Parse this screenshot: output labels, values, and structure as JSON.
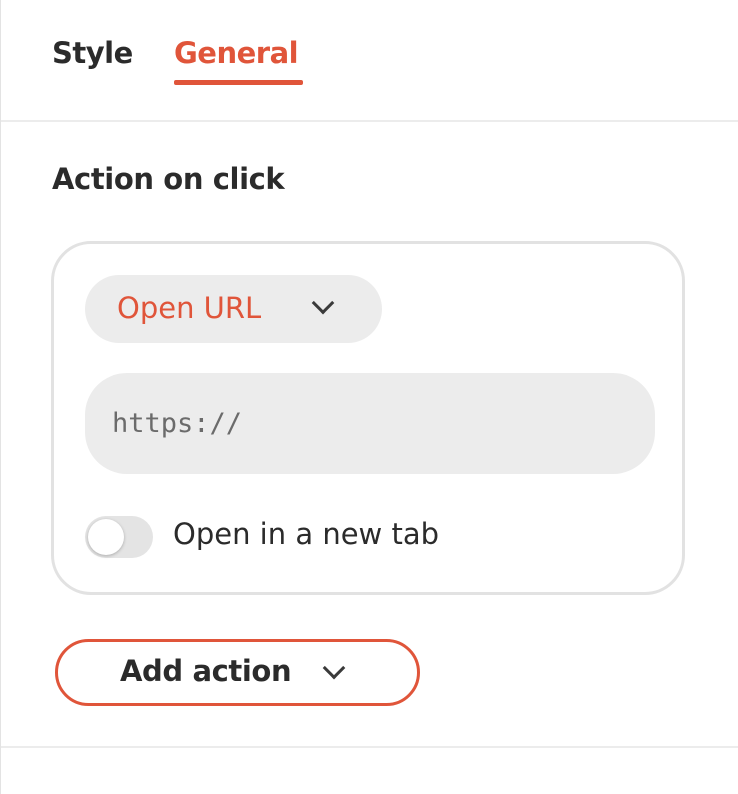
{
  "tabs": [
    {
      "label": "Style",
      "active": false
    },
    {
      "label": "General",
      "active": true
    }
  ],
  "section": {
    "title": "Action on click"
  },
  "action": {
    "type_selected": "Open URL",
    "type_icon": "chevron-down-icon",
    "url_value": "",
    "url_placeholder": "https://",
    "new_tab_label": "Open in a new tab",
    "new_tab_enabled": false
  },
  "add_action": {
    "label": "Add action",
    "icon": "chevron-down-icon"
  },
  "colors": {
    "accent": "#e0553a",
    "text": "#2b2b2b",
    "field_bg": "#ececec",
    "border": "#e2e2e2"
  }
}
